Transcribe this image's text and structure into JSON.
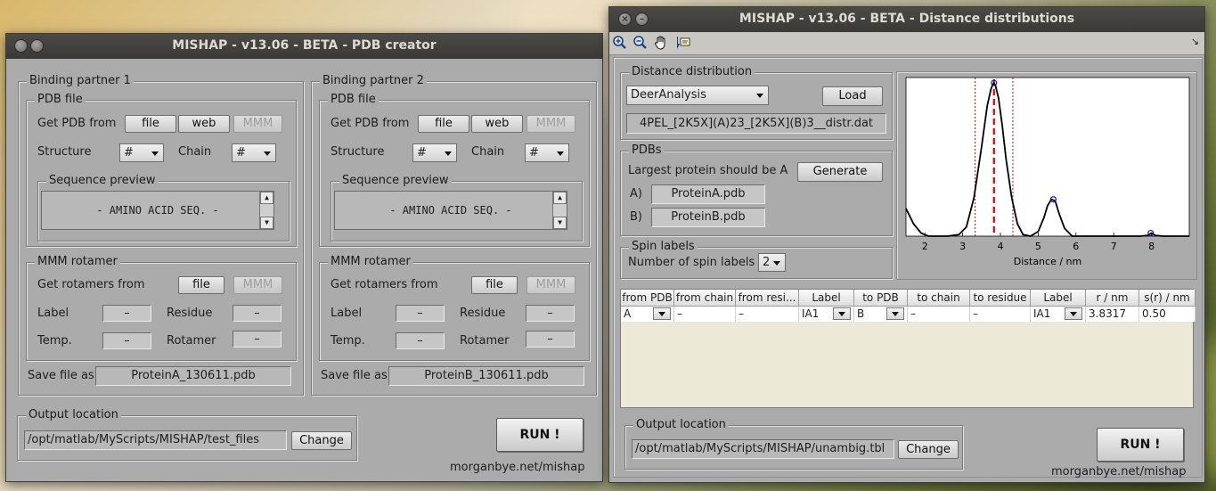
{
  "left_window": {
    "title": "MISHAP - v13.06 - BETA - PDB creator",
    "partners": [
      {
        "title": "Binding partner 1",
        "pdb_file": {
          "legend": "PDB file",
          "get_label": "Get PDB from",
          "file_btn": "file",
          "web_btn": "web",
          "mmm_btn": "MMM",
          "structure_label": "Structure",
          "structure_value": "#",
          "chain_label": "Chain",
          "chain_value": "#"
        },
        "sequence": {
          "legend": "Sequence preview",
          "text": "- AMINO ACID SEQ. -"
        },
        "mmm": {
          "legend": "MMM rotamer",
          "get_label": "Get rotamers from",
          "file_btn": "file",
          "mmm_btn": "MMM",
          "label_label": "Label",
          "label_value": "–",
          "residue_label": "Residue",
          "residue_value": "–",
          "temp_label": "Temp.",
          "temp_value": "–",
          "rotamer_label": "Rotamer",
          "rotamer_value": "–"
        },
        "save_label": "Save file as:",
        "save_value": "ProteinA_130611.pdb"
      },
      {
        "title": "Binding partner 2",
        "pdb_file": {
          "legend": "PDB file",
          "get_label": "Get PDB from",
          "file_btn": "file",
          "web_btn": "web",
          "mmm_btn": "MMM",
          "structure_label": "Structure",
          "structure_value": "#",
          "chain_label": "Chain",
          "chain_value": "#"
        },
        "sequence": {
          "legend": "Sequence preview",
          "text": "- AMINO ACID SEQ. -"
        },
        "mmm": {
          "legend": "MMM rotamer",
          "get_label": "Get rotamers from",
          "file_btn": "file",
          "mmm_btn": "MMM",
          "label_label": "Label",
          "label_value": "–",
          "residue_label": "Residue",
          "residue_value": "–",
          "temp_label": "Temp.",
          "temp_value": "–",
          "rotamer_label": "Rotamer",
          "rotamer_value": "–"
        },
        "save_label": "Save file as:",
        "save_value": "ProteinB_130611.pdb"
      }
    ],
    "output": {
      "legend": "Output location",
      "path": "/opt/matlab/MyScripts/MISHAP/test_files",
      "change_btn": "Change"
    },
    "run_btn": "RUN !",
    "credit": "morganbye.net/mishap"
  },
  "right_window": {
    "title": "MISHAP - v13.06 - BETA - Distance distributions",
    "toolbar_icons": [
      "zoom-in-icon",
      "zoom-out-icon",
      "pan-hand-icon",
      "data-cursor-icon"
    ],
    "distance": {
      "legend": "Distance distribution",
      "source_value": "DeerAnalysis",
      "load_btn": "Load",
      "file_name": "4PEL_[2K5X](A)23_[2K5X](B)3__distr.dat"
    },
    "pdbs": {
      "legend": "PDBs",
      "hint": "Largest protein should be A",
      "generate_btn": "Generate",
      "a_label": "A)",
      "a_value": "ProteinA.pdb",
      "b_label": "B)",
      "b_value": "ProteinB.pdb"
    },
    "spin": {
      "legend": "Spin labels",
      "count_label": "Number of spin labels",
      "count_value": "2"
    },
    "table": {
      "headers": [
        "from PDB",
        "from chain",
        "from resi...",
        "Label",
        "to PDB",
        "to chain",
        "to residue",
        "Label",
        "r / nm",
        "s(r) / nm"
      ],
      "row": [
        "A",
        "–",
        "–",
        "IA1",
        "B",
        "–",
        "–",
        "IA1",
        "3.8317",
        "0.50"
      ]
    },
    "output": {
      "legend": "Output location",
      "path": "/opt/matlab/MyScripts/MISHAP/unambig.tbl",
      "change_btn": "Change"
    },
    "run_btn": "RUN !",
    "credit": "morganbye.net/mishap"
  },
  "chart_data": {
    "type": "line",
    "xlabel": "Distance / nm",
    "ylabel": "",
    "xlim": [
      1.5,
      9.0
    ],
    "ylim": [
      0,
      1.0
    ],
    "xticks": [
      2,
      3,
      4,
      5,
      6,
      7,
      8
    ],
    "series": [
      {
        "x": [
          1.5,
          1.7,
          1.9,
          2.1,
          2.3,
          2.6,
          2.9,
          3.1,
          3.3,
          3.5,
          3.65,
          3.75,
          3.8,
          3.83,
          3.87,
          3.95,
          4.05,
          4.15,
          4.3,
          4.45,
          4.6,
          4.8,
          5.0,
          5.15,
          5.25,
          5.35,
          5.45,
          5.55,
          5.7,
          5.9,
          6.2,
          6.6,
          7.0,
          7.4,
          7.7,
          7.9,
          8.0,
          8.1,
          8.3,
          8.6,
          9.0
        ],
        "y": [
          0.18,
          0.08,
          0.02,
          0.0,
          0.0,
          0.0,
          0.01,
          0.06,
          0.25,
          0.58,
          0.85,
          0.96,
          0.99,
          1.0,
          0.98,
          0.9,
          0.72,
          0.5,
          0.25,
          0.08,
          0.01,
          0.0,
          0.03,
          0.12,
          0.2,
          0.24,
          0.23,
          0.15,
          0.05,
          0.0,
          0.0,
          0.0,
          0.0,
          0.0,
          0.0,
          0.005,
          0.02,
          0.005,
          0.0,
          0.0,
          0.0
        ]
      }
    ],
    "peaks": [
      {
        "x": 3.83,
        "y": 1.0
      },
      {
        "x": 5.4,
        "y": 0.24
      },
      {
        "x": 7.98,
        "y": 0.02
      }
    ],
    "mean_line": 3.83,
    "bounds": [
      3.33,
      4.33
    ],
    "colors": {
      "curve": "#000000",
      "mean": "#e00000",
      "bounds": "#e00000",
      "marker": "#1a1aa0"
    }
  }
}
